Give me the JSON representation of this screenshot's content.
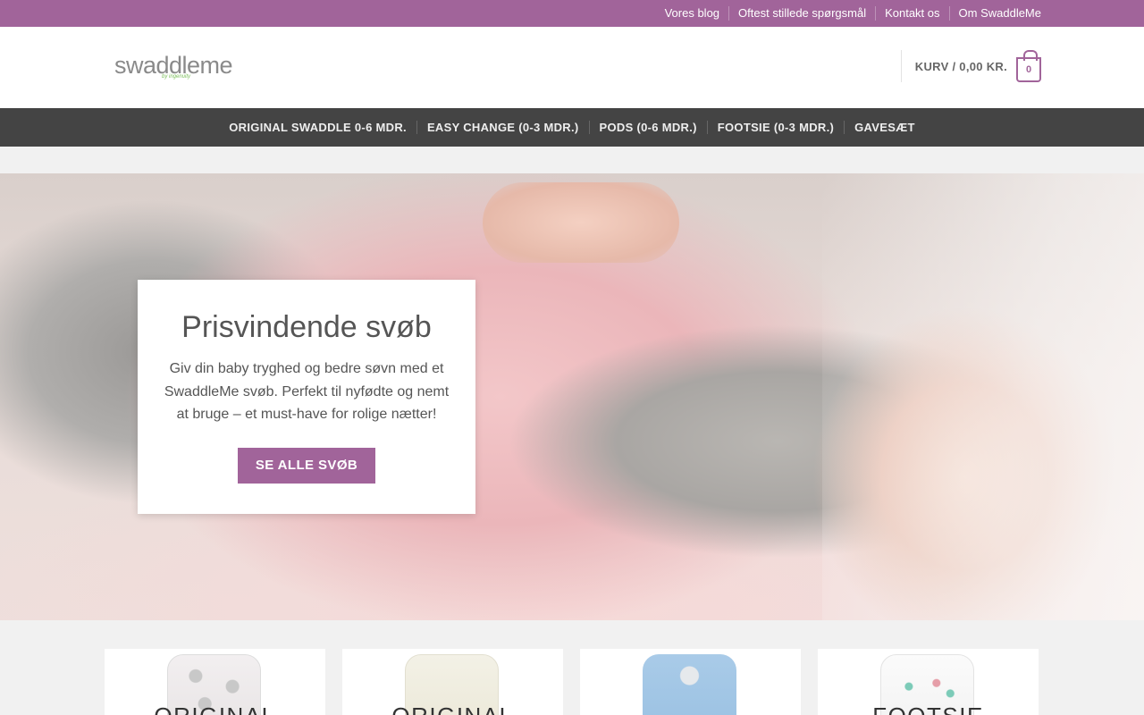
{
  "topbar": {
    "links": [
      "Vores blog",
      "Oftest stillede spørgsmål",
      "Kontakt os",
      "Om SwaddleMe"
    ]
  },
  "header": {
    "logo": {
      "text": "swaddleme",
      "subtext": "by ingenuity"
    },
    "cart": {
      "label": "KURV / 0,00 KR.",
      "count": "0"
    }
  },
  "nav": {
    "items": [
      "ORIGINAL SWADDLE 0-6 MDR.",
      "EASY CHANGE (0-3 MDR.)",
      "PODS (0-6 MDR.)",
      "FOOTSIE (0-3 MDR.)",
      "GAVESÆT"
    ]
  },
  "hero": {
    "title": "Prisvindende svøb",
    "text": "Giv din baby tryghed og bedre søvn med et SwaddleMe svøb. Perfekt til nyfødte og nemt at bruge – et must-have for rolige nætter!",
    "button": "SE ALLE SVØB"
  },
  "products": [
    {
      "title": "ORIGINAL"
    },
    {
      "title": "ORIGINAL"
    },
    {
      "title": ""
    },
    {
      "title": "FOOTSIE"
    }
  ],
  "colors": {
    "brand": "#a1649a",
    "nav_bg": "#444444",
    "page_bg": "#f1f1f1"
  }
}
